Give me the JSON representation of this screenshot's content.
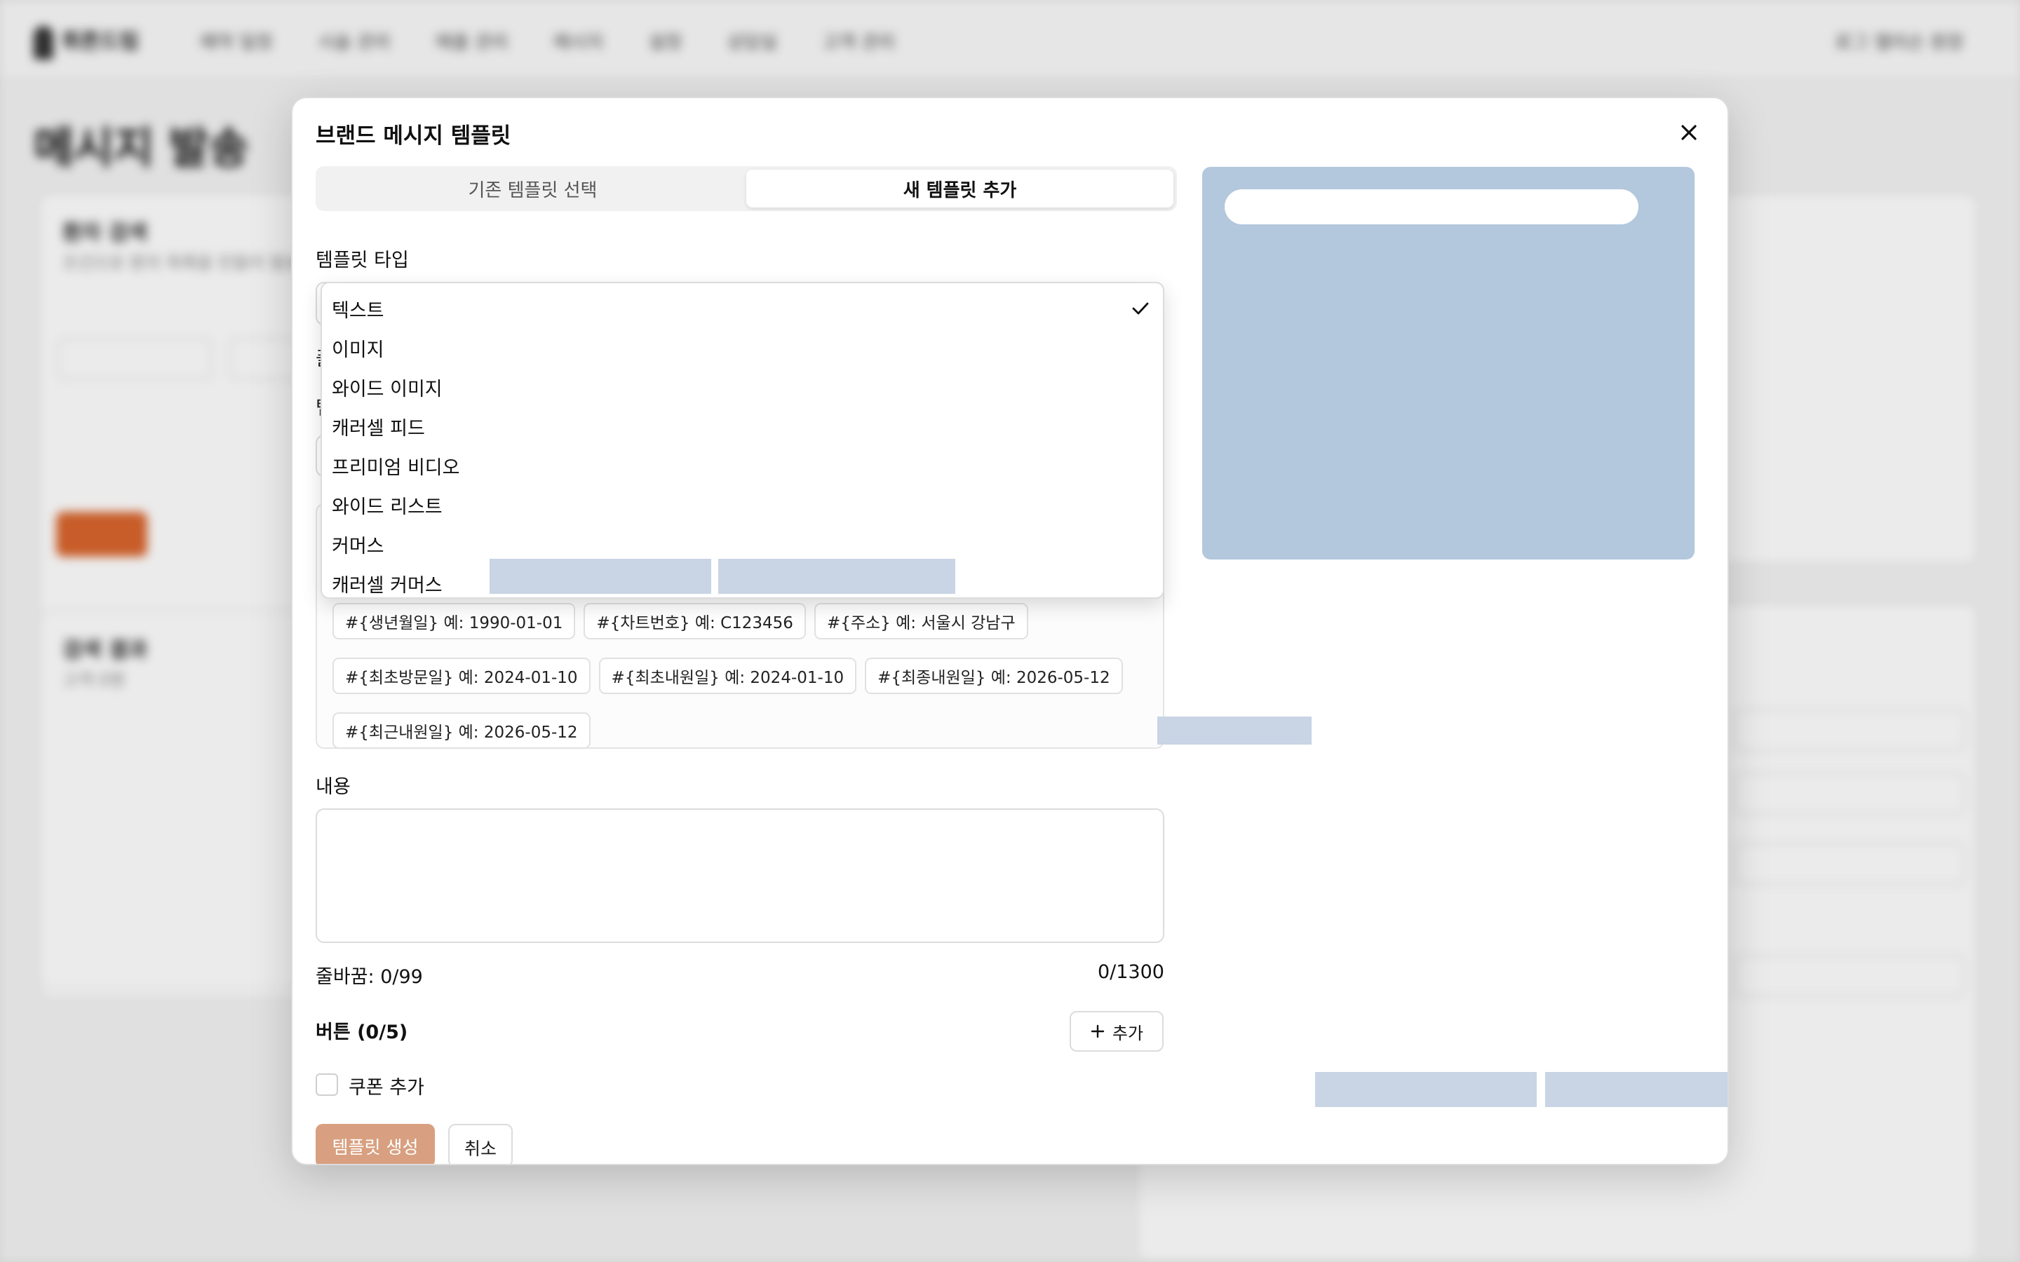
{
  "background": {
    "logo_text": "휘튼드림",
    "nav_items": [
      "예약 일정",
      "시술 관리",
      "매출 관리",
      "메시지",
      "설정",
      "상담실",
      "고객 관리"
    ],
    "nav_right": "로그 앨리슨 원장",
    "page_title": "메시지 발송",
    "card1_title": "환자 검색",
    "card1_sub": "조건으로 환자 목록을 만들어 발송하세요",
    "card2_title": "검색 결과",
    "card2_sub": "고객 0명"
  },
  "modal": {
    "title": "브랜드 메시지 템플릿",
    "tabs": [
      {
        "label": "기존 템플릿 선택",
        "active": false
      },
      {
        "label": "새 템플릿 추가",
        "active": true
      }
    ],
    "template_type_label": "템플릿 타입",
    "template_type_options": [
      "텍스트",
      "이미지",
      "와이드 이미지",
      "캐러셀 피드",
      "프리미엄 비디오",
      "와이드 리스트",
      "커머스",
      "캐러셀 커머스"
    ],
    "template_type_selected": "텍스트",
    "variable_chips": [
      "#{생년월일} 예: 1990-01-01",
      "#{차트번호} 예: C123456",
      "#{주소} 예: 서울시 강남구",
      "#{최초방문일} 예: 2024-01-10",
      "#{최초내원일} 예: 2024-01-10",
      "#{최종내원일} 예: 2026-05-12",
      "#{최근내원일} 예: 2026-05-12"
    ],
    "content_label": "내용",
    "content_value": "",
    "line_break_counter": "줄바꿈: 0/99",
    "char_counter": "0/1300",
    "buttons_label": "버튼 (0/5)",
    "add_button_label": "추가",
    "coupon_label": "쿠폰 추가",
    "coupon_checked": false,
    "create_button": "템플릿 생성",
    "cancel_button": "취소"
  },
  "colors": {
    "preview_bg": "#b3c7dd",
    "create_button_bg": "#d8a080",
    "background_accent": "#d9652d"
  }
}
